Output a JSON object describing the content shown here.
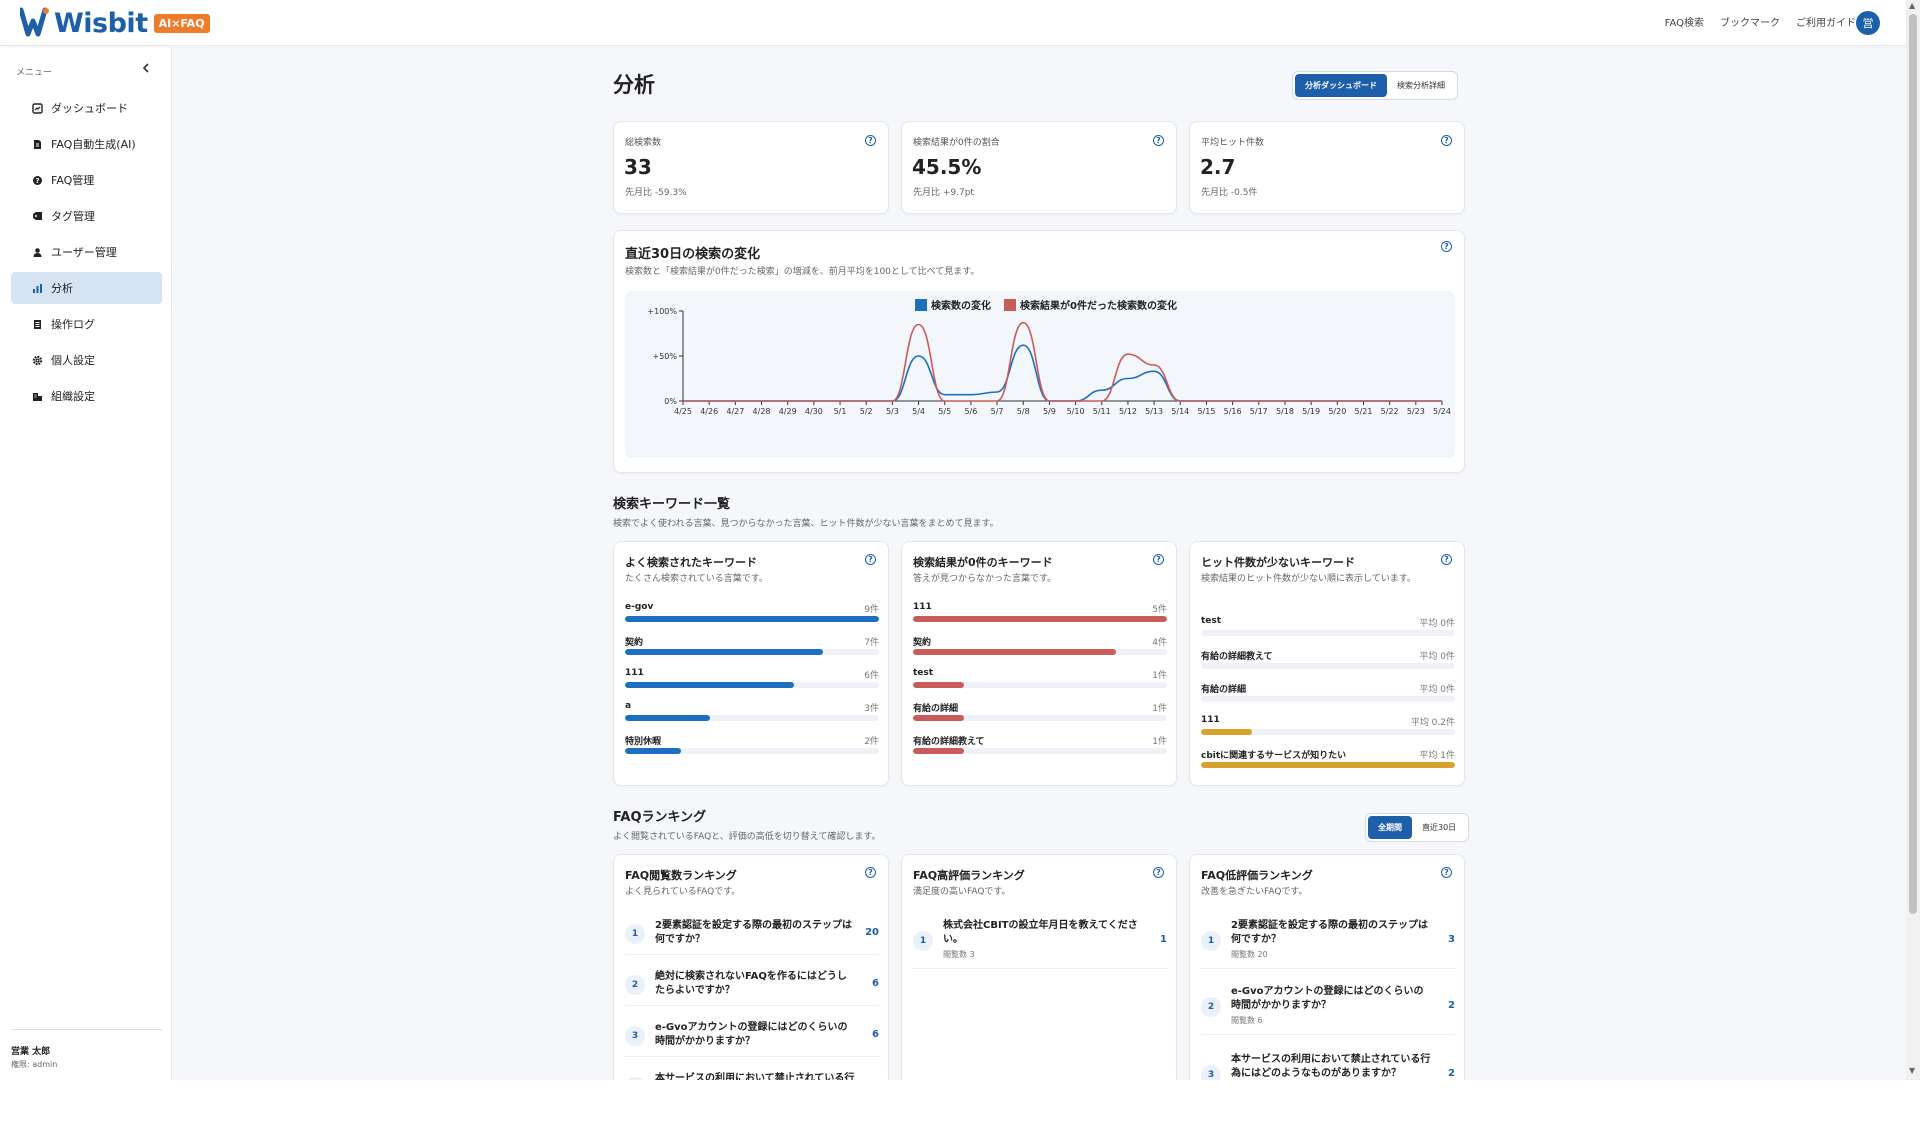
{
  "header": {
    "logo_text": "Wisbit",
    "logo_badge": "AI×FAQ",
    "links": [
      "FAQ検索",
      "ブックマーク",
      "ご利用ガイド"
    ],
    "avatar_initial": "営"
  },
  "sidebar": {
    "menu_label": "メニュー",
    "collapse_icon": "chevron-left-icon",
    "items": [
      {
        "label": "ダッシュボード",
        "icon": "dashboard-icon",
        "active": false
      },
      {
        "label": "FAQ自動生成(AI)",
        "icon": "document-icon",
        "active": false
      },
      {
        "label": "FAQ管理",
        "icon": "help-circle-icon",
        "active": false
      },
      {
        "label": "タグ管理",
        "icon": "tag-icon",
        "active": false
      },
      {
        "label": "ユーザー管理",
        "icon": "user-icon",
        "active": false
      },
      {
        "label": "分析",
        "icon": "bar-chart-icon",
        "active": true
      },
      {
        "label": "操作ログ",
        "icon": "log-icon",
        "active": false
      },
      {
        "label": "個人設定",
        "icon": "gear-icon",
        "active": false
      },
      {
        "label": "組織設定",
        "icon": "building-icon",
        "active": false
      }
    ],
    "user": {
      "name": "営業 太郎",
      "role": "権限: admin"
    }
  },
  "page": {
    "title": "分析",
    "view_toggle": [
      "分析ダッシュボード",
      "検索分析詳細"
    ]
  },
  "stats": [
    {
      "label": "総検索数",
      "value": "33",
      "sub": "先月比 -59.3%"
    },
    {
      "label": "検索結果が0件の割合",
      "value": "45.5%",
      "sub": "先月比 +9.7pt"
    },
    {
      "label": "平均ヒット件数",
      "value": "2.7",
      "sub": "先月比 -0.5件"
    }
  ],
  "trend": {
    "title": "直近30日の検索の変化",
    "desc": "検索数と「検索結果が0件だった検索」の増減を、前月平均を100として比べて見ます。"
  },
  "chart_data": {
    "type": "line",
    "title": "",
    "xlabel": "",
    "ylabel": "",
    "y_ticks": [
      "+100%",
      "+50%",
      "0%"
    ],
    "ylim": [
      0,
      100
    ],
    "legend_position": "top-center",
    "grid": false,
    "x": [
      "4/25",
      "4/26",
      "4/27",
      "4/28",
      "4/29",
      "4/30",
      "5/1",
      "5/2",
      "5/3",
      "5/4",
      "5/5",
      "5/6",
      "5/7",
      "5/8",
      "5/9",
      "5/10",
      "5/11",
      "5/12",
      "5/13",
      "5/14",
      "5/15",
      "5/16",
      "5/17",
      "5/18",
      "5/19",
      "5/20",
      "5/21",
      "5/22",
      "5/23",
      "5/24"
    ],
    "series": [
      {
        "name": "検索数の変化",
        "color": "#1d6fc0",
        "values": [
          0,
          0,
          0,
          0,
          0,
          0,
          0,
          0,
          0,
          50,
          7,
          7,
          10,
          62,
          0,
          0,
          12,
          25,
          33,
          0,
          0,
          0,
          0,
          0,
          0,
          0,
          0,
          0,
          0,
          0
        ]
      },
      {
        "name": "検索結果が0件だった検索数の変化",
        "color": "#c95b5b",
        "values": [
          0,
          0,
          0,
          0,
          0,
          0,
          0,
          0,
          0,
          85,
          0,
          0,
          0,
          87,
          0,
          0,
          0,
          52,
          40,
          0,
          0,
          0,
          0,
          0,
          0,
          0,
          0,
          0,
          0,
          0
        ]
      }
    ]
  },
  "keywords": {
    "title": "検索キーワード一覧",
    "desc": "検索でよく使われる言葉、見つからなかった言葉、ヒット件数が少ない言葉をまとめて見ます。",
    "frequent": {
      "title": "よく検索されたキーワード",
      "desc": "たくさん検索されている言葉です。",
      "color": "#1d6fc0",
      "items": [
        {
          "name": "e-gov",
          "count": "9件",
          "value": 9
        },
        {
          "name": "契約",
          "count": "7件",
          "value": 7
        },
        {
          "name": "111",
          "count": "6件",
          "value": 6
        },
        {
          "name": "a",
          "count": "3件",
          "value": 3
        },
        {
          "name": "特別休暇",
          "count": "2件",
          "value": 2
        }
      ]
    },
    "zero": {
      "title": "検索結果が0件のキーワード",
      "desc": "答えが見つからなかった言葉です。",
      "color": "#c95b5b",
      "items": [
        {
          "name": "111",
          "count": "5件",
          "value": 5
        },
        {
          "name": "契約",
          "count": "4件",
          "value": 4
        },
        {
          "name": "test",
          "count": "1件",
          "value": 1
        },
        {
          "name": "有給の詳細",
          "count": "1件",
          "value": 1
        },
        {
          "name": "有給の詳細教えて",
          "count": "1件",
          "value": 1
        }
      ]
    },
    "low": {
      "title": "ヒット件数が少ないキーワード",
      "desc": "検索結果のヒット件数が少ない順に表示しています。",
      "color": "#d9a12b",
      "items": [
        {
          "name": "test",
          "count": "平均 0件",
          "value": 0
        },
        {
          "name": "有給の詳細教えて",
          "count": "平均 0件",
          "value": 0
        },
        {
          "name": "有給の詳細",
          "count": "平均 0件",
          "value": 0
        },
        {
          "name": "111",
          "count": "平均 0.2件",
          "value": 0.2
        },
        {
          "name": "cbitに関連するサービスが知りたい",
          "count": "平均 1件",
          "value": 1
        }
      ]
    }
  },
  "ranking": {
    "title": "FAQランキング",
    "desc": "よく閲覧されているFAQと、評価の高低を切り替えて確認します。",
    "toggle": [
      "全期間",
      "直近30日"
    ],
    "views": {
      "title": "FAQ閲覧数ランキング",
      "desc": "よく見られているFAQです。",
      "items": [
        {
          "rank": "1",
          "text": "2要素認証を設定する際の最初のステップは何ですか？",
          "value": "20"
        },
        {
          "rank": "2",
          "text": "絶対に検索されないFAQを作るにはどうしたらよいですか？",
          "value": "6"
        },
        {
          "rank": "3",
          "text": "e-Gvoアカウントの登録にはどのくらいの時間がかかりますか？",
          "value": "6"
        },
        {
          "rank": "4",
          "text": "本サービスの利用において禁止されている行",
          "value": ""
        }
      ]
    },
    "high": {
      "title": "FAQ高評価ランキング",
      "desc": "満足度の高いFAQです。",
      "items": [
        {
          "rank": "1",
          "text": "株式会社CBITの設立年月日を教えてください。",
          "sub": "閲覧数 3",
          "value": "1"
        }
      ]
    },
    "low": {
      "title": "FAQ低評価ランキング",
      "desc": "改善を急ぎたいFAQです。",
      "items": [
        {
          "rank": "1",
          "text": "2要素認証を設定する際の最初のステップは何ですか？",
          "sub": "閲覧数 20",
          "value": "3"
        },
        {
          "rank": "2",
          "text": "e-Gvoアカウントの登録にはどのくらいの時間がかかりますか？",
          "sub": "閲覧数 6",
          "value": "2"
        },
        {
          "rank": "3",
          "text": "本サービスの利用において禁止されている行為にはどのようなものがありますか？",
          "sub": "",
          "value": "2"
        }
      ]
    }
  }
}
